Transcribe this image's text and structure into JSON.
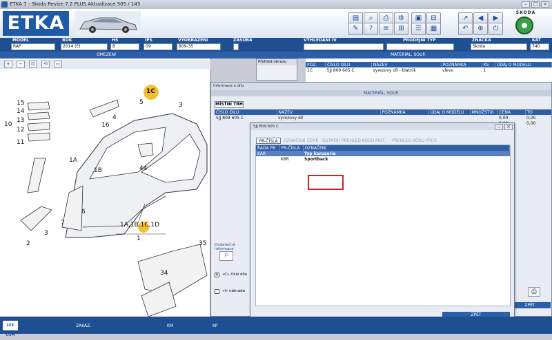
{
  "window": {
    "title": "ETKA 7 - Skoda Revize 7.2 PLUS Aktualizace 505 / 143"
  },
  "header": {
    "logo": "ETKA",
    "brand": "ŠKODA",
    "icons": [
      "catalog-icon",
      "search-icon",
      "print-icon",
      "car-icon",
      "settings-icon",
      "help-icon",
      "parts-list-icon",
      "cart-icon",
      "pin-icon",
      "tools-icon",
      "arrow-left-icon",
      "arrow-right-icon",
      "globe-icon",
      "bolt-icon",
      "info-icon",
      "exit-icon"
    ]
  },
  "filters": [
    {
      "label": "MODEL",
      "value": "RAP"
    },
    {
      "label": "ROK",
      "value": "2014 (E)"
    },
    {
      "label": "HS",
      "value": "B"
    },
    {
      "label": "IPS",
      "value": "09"
    },
    {
      "label": "VYOBRAZENI",
      "value": "809-35"
    },
    {
      "label": "ZÁSOBA",
      "value": ""
    },
    {
      "label": "VYHLEDÁNÍ IV",
      "value": ""
    },
    {
      "label": "PRODEJNÍ TYP",
      "value": ""
    },
    {
      "label": "ZNACKA",
      "value": "Skoda"
    },
    {
      "label": "KAT",
      "value": "740"
    }
  ],
  "subbar": {
    "left": "OMEZENÍ",
    "right": "MATERIÁL, SOUP."
  },
  "zoom_buttons": [
    "zoom-in-icon",
    "zoom-out-icon",
    "zoom-fit-icon",
    "zoom-reset-icon",
    "zoom-window-icon"
  ],
  "diagram": {
    "labels": [
      "15",
      "14",
      "13",
      "12",
      "11",
      "10",
      "16",
      "4",
      "5",
      "1C",
      "3",
      "1A",
      "1B",
      "44",
      "6",
      "7",
      "2",
      "3",
      "1A,1B,1C,1D",
      "1",
      "35",
      "34"
    ]
  },
  "prehled": {
    "title": "Přehled obrazu"
  },
  "top_table": {
    "headers": [
      "POZ.",
      "ČÍSLO DÍLU",
      "NÁZEV",
      "POZNÁMKA",
      "KS",
      "ÚDAJ O MODELU"
    ],
    "rows": [
      [
        "1C",
        "5JJ 809 605 C",
        "vyrezovy díl - blatník",
        "vlevo",
        "1",
        ""
      ]
    ]
  },
  "info_dialog": {
    "title": "Informace o dílu",
    "section": "MATERIÁL, SOUP.",
    "mistni_button": "MÍSTNÍ TRH",
    "headers": [
      "ČÍSLO DÍLU",
      "NÁZEV",
      "POZNÁMKA",
      "ÚDAJ O MODELU",
      "MNOŽSTVÍ",
      "CENA",
      "TO"
    ],
    "rows": [
      [
        "5JJ 809 605 C",
        "vyrezovy díl",
        "",
        "",
        "",
        "0,00",
        "0,00"
      ],
      [
        "",
        "",
        "",
        "",
        "",
        "0,00",
        "0,00"
      ]
    ],
    "dodatecne": "Dodatečné informace",
    "check1": "«C» číslo dílu",
    "check2": "«I» náhrada",
    "zpet": "ZPĚT"
  },
  "popup": {
    "title": "5JJ 809 605 C",
    "tabs": [
      "PR-ČÍSLA",
      "OZNAČENÍ ZEMĚ",
      "OSTATNÍ",
      "PŘEHLED KÓDU MOT.",
      "PŘEHLED KÓDU PŘEV."
    ],
    "headers": [
      "ŘADA PR",
      "PR-ČÍSLA",
      "OZNAČENÍ"
    ],
    "rows": [
      [
        "KAR",
        "",
        "Typ karoserie"
      ],
      [
        "",
        "K8R",
        "Sportback"
      ]
    ],
    "back": "ZPĚT"
  },
  "statusbar": {
    "logo": "LEX COM",
    "items": [
      "ZAKÁZ.",
      "KM",
      "KP"
    ]
  }
}
